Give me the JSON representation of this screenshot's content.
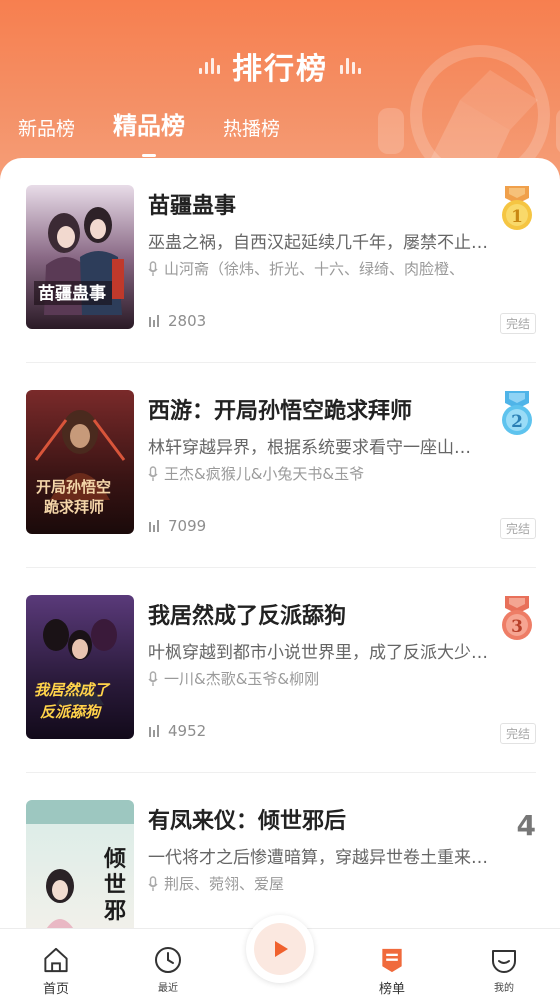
{
  "header": {
    "title": "排行榜",
    "tabs": [
      {
        "label": "新品榜",
        "active": false
      },
      {
        "label": "精品榜",
        "active": true
      },
      {
        "label": "热播榜",
        "active": false
      }
    ]
  },
  "books": [
    {
      "rank": 1,
      "title": "苗疆蛊事",
      "desc": "巫蛊之祸，自西汉起延续几千年，屡禁不止…",
      "author": "山河斋（徐炜、折光、十六、绿绮、肉脸橙、",
      "plays": "2803",
      "status": "完结",
      "medal": "gold-medal-icon"
    },
    {
      "rank": 2,
      "title": "西游：开局孙悟空跪求拜师",
      "desc": "林轩穿越异界，根据系统要求看守一座山…",
      "author": "王杰&疯猴儿&小兔天书&玉爷",
      "plays": "7099",
      "status": "完结",
      "medal": "silver-medal-icon"
    },
    {
      "rank": 3,
      "title": "我居然成了反派舔狗",
      "desc": "叶枫穿越到都市小说世界里，成了反派大少…",
      "author": "一川&杰歌&玉爷&柳刚",
      "plays": "4952",
      "status": "完结",
      "medal": "bronze-medal-icon"
    },
    {
      "rank": 4,
      "rank_label": "4",
      "title": "有凤来仪：倾世邪后",
      "desc": "一代将才之后惨遭暗算，穿越异世卷土重来…",
      "author": "荆辰、菀翎、爱屋"
    }
  ],
  "nav": {
    "home": "首页",
    "recent": "最近",
    "ranking": "榜单",
    "mine": "我的"
  },
  "colors": {
    "header_top": "#f77f4f",
    "accent": "#f06a3c",
    "text_dark": "#222222",
    "text_gray": "#9a9a9a"
  }
}
